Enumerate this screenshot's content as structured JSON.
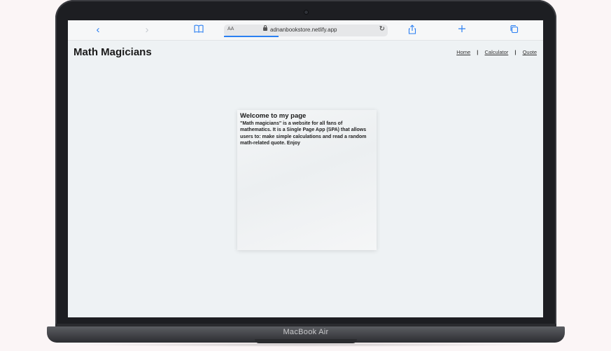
{
  "browser": {
    "font_size_label": "AA",
    "url": "adnanbookstore.netlify.app",
    "icons": {
      "back": "chevron-left-icon",
      "forward": "chevron-right-icon",
      "bookmarks": "book-icon",
      "share": "share-icon",
      "new_tab": "plus-icon",
      "tabs": "tabs-icon",
      "reload": "reload-icon",
      "lock": "lock-icon"
    },
    "accent_color": "#2a7ff2"
  },
  "page": {
    "title": "Math Magicians",
    "nav": [
      "Home",
      "Calculator",
      "Quote"
    ],
    "nav_separator": "|",
    "welcome": {
      "heading": "Welcome to my page",
      "body": "\"Math magicians\" is a website for all fans of mathematics. It is a Single Page App (SPA) that allows users to: make simple calculations and read a random math-related quote. Enjoy"
    }
  },
  "device": {
    "label": "MacBook Air"
  }
}
